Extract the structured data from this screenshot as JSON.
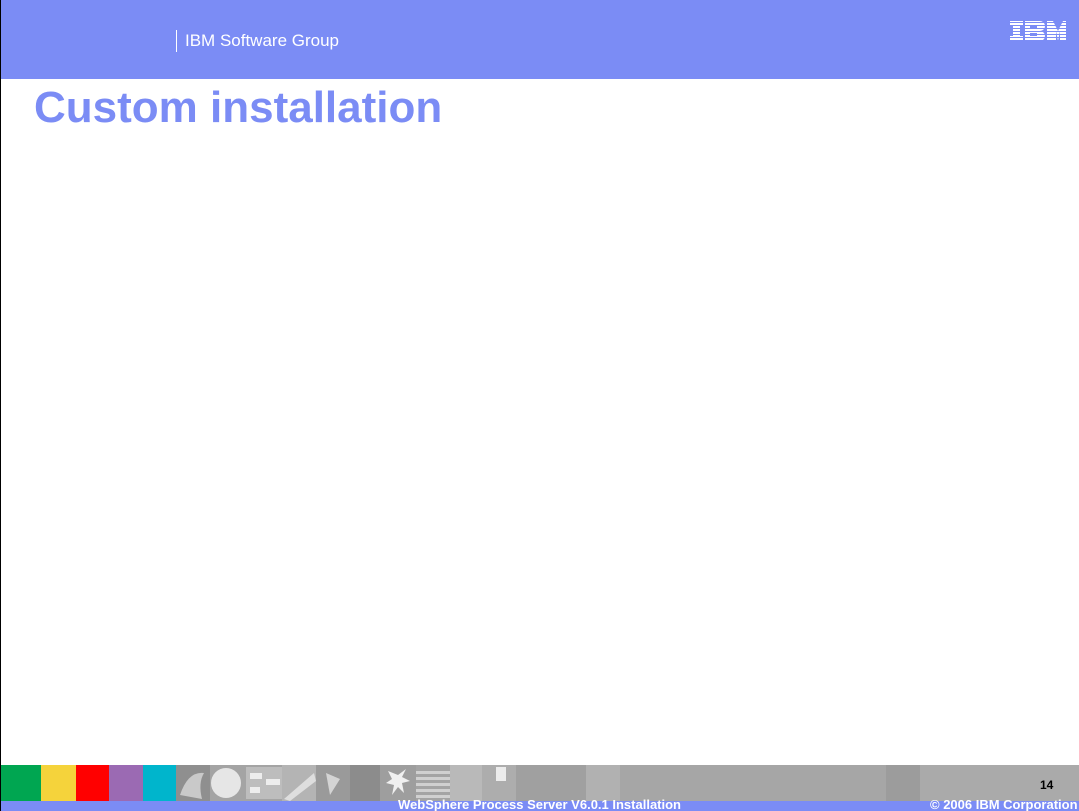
{
  "header": {
    "group": "IBM Software Group",
    "logo_text": "IBM",
    "background": "#7b8cf5"
  },
  "slide": {
    "title": "Custom installation",
    "title_color": "#7b8cf5"
  },
  "footer": {
    "presentation_title": "WebSphere Process Server V6.0.1 Installation",
    "copyright": "© 2006 IBM Corporation",
    "page_number": "14",
    "color_swatches": [
      "#00a651",
      "#f5d33b",
      "#ff0000",
      "#9b6ab3",
      "#00b5cc"
    ]
  }
}
